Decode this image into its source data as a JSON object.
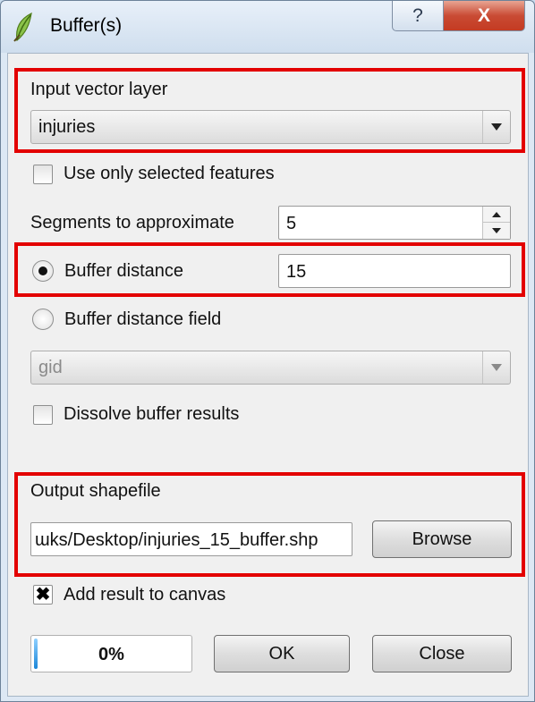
{
  "window": {
    "title": "Buffer(s)",
    "help_label": "?",
    "close_label": "X"
  },
  "input_layer": {
    "label": "Input vector layer",
    "value": "injuries"
  },
  "use_selected": {
    "label": "Use only selected features",
    "checked": false
  },
  "segments": {
    "label": "Segments to approximate",
    "value": "5"
  },
  "buffer_distance": {
    "label": "Buffer distance",
    "value": "15",
    "selected": true
  },
  "buffer_field": {
    "label": "Buffer distance field",
    "value": "gid",
    "selected": false
  },
  "dissolve": {
    "label": "Dissolve buffer results",
    "checked": false
  },
  "output": {
    "label": "Output shapefile",
    "value": "ɯks/Desktop/injuries_15_buffer.shp",
    "browse_label": "Browse"
  },
  "add_to_canvas": {
    "label": "Add result to canvas",
    "checked": true,
    "mark": "✖"
  },
  "progress": {
    "text": "0%",
    "value": 0
  },
  "buttons": {
    "ok": "OK",
    "close": "Close"
  },
  "colors": {
    "highlight": "#e30000",
    "progress_accent": "#1a86d8"
  },
  "icons": {
    "app": "qgis-leaf-icon",
    "dropdown": "triangle-down",
    "spin_up": "triangle-up",
    "spin_down": "triangle-down"
  }
}
